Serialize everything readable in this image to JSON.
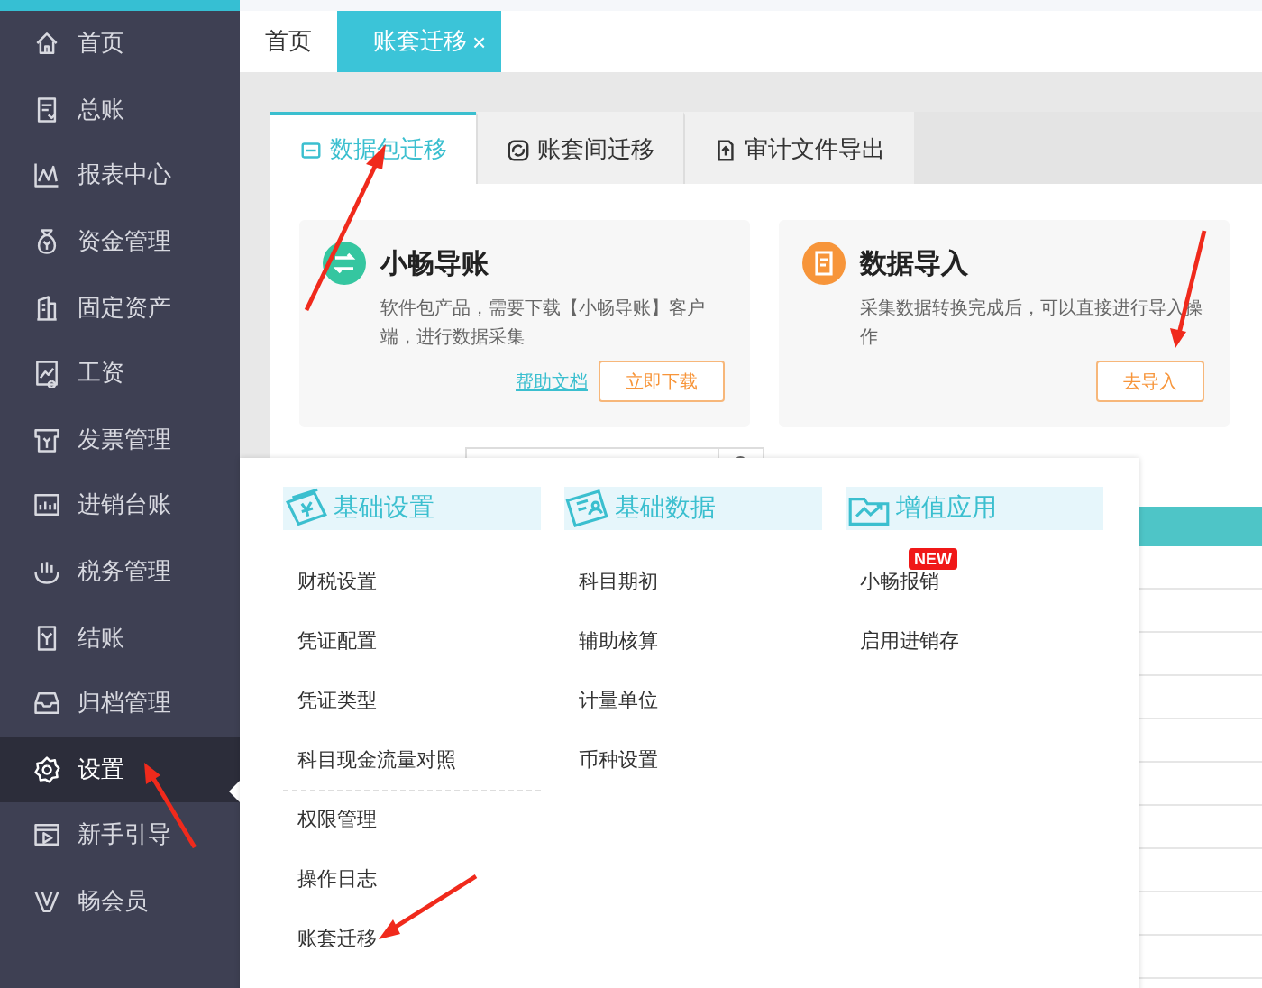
{
  "sidebar": {
    "items": [
      {
        "label": "首页",
        "selected": false
      },
      {
        "label": "总账",
        "selected": false
      },
      {
        "label": "报表中心",
        "selected": false
      },
      {
        "label": "资金管理",
        "selected": false
      },
      {
        "label": "固定资产",
        "selected": false
      },
      {
        "label": "工资",
        "selected": false
      },
      {
        "label": "发票管理",
        "selected": false
      },
      {
        "label": "进销台账",
        "selected": false
      },
      {
        "label": "税务管理",
        "selected": false
      },
      {
        "label": "结账",
        "selected": false
      },
      {
        "label": "归档管理",
        "selected": false
      },
      {
        "label": "设置",
        "selected": true
      },
      {
        "label": "新手引导",
        "selected": false
      },
      {
        "label": "畅会员",
        "selected": false
      }
    ]
  },
  "page_tabs": [
    {
      "label": "首页",
      "selected": false
    },
    {
      "label": "账套迁移",
      "selected": true,
      "close": "×"
    }
  ],
  "sub_tabs": [
    {
      "label": "数据包迁移",
      "selected": true
    },
    {
      "label": "账套间迁移",
      "selected": false
    },
    {
      "label": "审计文件导出",
      "selected": false
    }
  ],
  "cards": [
    {
      "title": "小畅导账",
      "description": "软件包产品，需要下载【小畅导账】客户端，进行数据采集",
      "link": "帮助文档",
      "button": "立即下载",
      "color": "#35c6a0"
    },
    {
      "title": "数据导入",
      "description": "采集数据转换完成后，可以直接进行导入操作",
      "button": "去导入",
      "color": "#f7953a"
    }
  ],
  "settings_menu": {
    "columns": [
      {
        "title": "基础设置",
        "groups": [
          [
            {
              "label": "财税设置"
            },
            {
              "label": "凭证配置"
            },
            {
              "label": "凭证类型"
            },
            {
              "label": "科目现金流量对照"
            }
          ],
          [
            {
              "label": "权限管理"
            },
            {
              "label": "操作日志"
            },
            {
              "label": "账套迁移"
            }
          ]
        ]
      },
      {
        "title": "基础数据",
        "groups": [
          [
            {
              "label": "科目期初"
            },
            {
              "label": "辅助核算"
            },
            {
              "label": "计量单位"
            },
            {
              "label": "币种设置"
            }
          ]
        ]
      },
      {
        "title": "增值应用",
        "groups": [
          [
            {
              "label": "小畅报销",
              "badge": "NEW"
            },
            {
              "label": "启用进销存"
            }
          ]
        ]
      }
    ]
  }
}
